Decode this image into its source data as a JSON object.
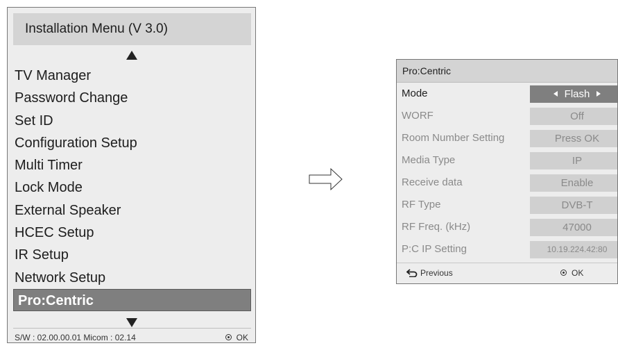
{
  "installation_menu": {
    "title": "Installation Menu (V 3.0)",
    "items": [
      "TV Manager",
      "Password Change",
      "Set ID",
      "Configuration Setup",
      "Multi Timer",
      "Lock Mode",
      "External Speaker",
      "HCEC Setup",
      "IR Setup",
      "Network Setup",
      "Pro:Centric"
    ],
    "selected_item": "Pro:Centric",
    "footer_version": "S/W : 02.00.00.01 Micom : 02.14",
    "ok_label": "OK"
  },
  "procentric_menu": {
    "title": "Pro:Centric",
    "rows": [
      {
        "label": "Mode",
        "value": "Flash"
      },
      {
        "label": "WORF",
        "value": "Off"
      },
      {
        "label": "Room Number Setting",
        "value": "Press OK"
      },
      {
        "label": "Media Type",
        "value": "IP"
      },
      {
        "label": "Receive data",
        "value": "Enable"
      },
      {
        "label": "RF Type",
        "value": "DVB-T"
      },
      {
        "label": "RF Freq. (kHz)",
        "value": "47000"
      },
      {
        "label": "P:C IP Setting",
        "value": "10.19.224.42:80"
      }
    ],
    "previous_label": "Previous",
    "ok_label": "OK"
  },
  "colors": {
    "panel_bg": "#ededed",
    "header_bg": "#d4d4d4",
    "selected_bg": "#7f7f7f",
    "value_bg": "#d0d0d0",
    "dimmed_text": "#8a8a8a"
  }
}
